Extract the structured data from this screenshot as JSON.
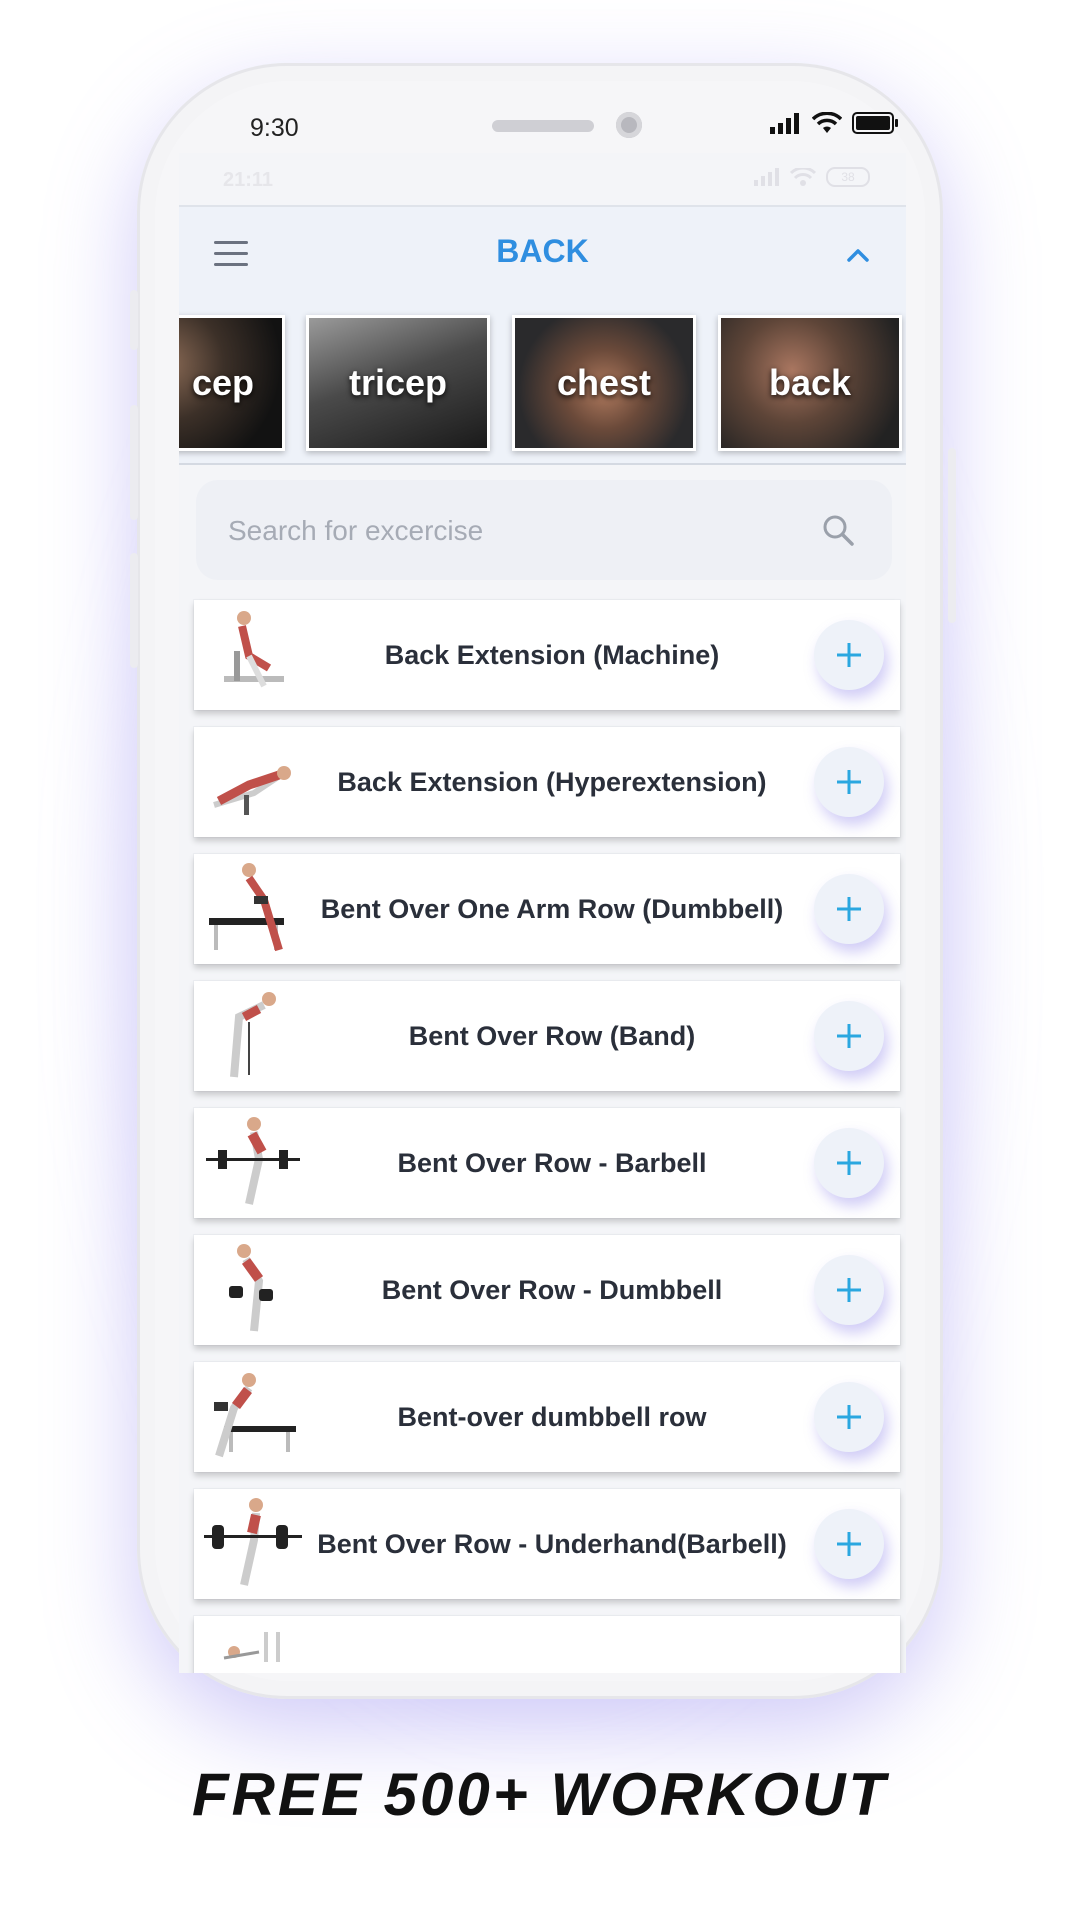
{
  "device": {
    "time": "9:30"
  },
  "screen": {
    "ghost_time": "21:11",
    "ghost_battery": "38"
  },
  "header": {
    "title": "BACK"
  },
  "categories": [
    {
      "label": "cep"
    },
    {
      "label": "tricep"
    },
    {
      "label": "chest"
    },
    {
      "label": "back"
    }
  ],
  "search": {
    "placeholder": "Search for excercise"
  },
  "exercises": [
    {
      "name": "Back Extension (Machine)"
    },
    {
      "name": "Back Extension (Hyperextension)"
    },
    {
      "name": "Bent Over One Arm Row (Dumbbell)"
    },
    {
      "name": "Bent Over Row (Band)"
    },
    {
      "name": "Bent Over Row - Barbell"
    },
    {
      "name": "Bent Over Row - Dumbbell"
    },
    {
      "name": "Bent-over dumbbell row"
    },
    {
      "name": "Bent Over Row - Underhand(Barbell)"
    }
  ],
  "footer": {
    "tagline": "FREE 500+ WORKOUT"
  },
  "colors": {
    "accent": "#2f8ee0",
    "plus": "#2aa7e0",
    "glow": "#aaa0ff"
  }
}
